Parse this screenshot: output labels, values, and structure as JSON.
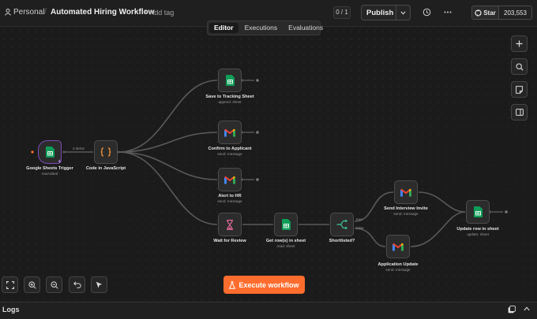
{
  "header": {
    "project": "Personal",
    "separator": "/",
    "workflow_title": "Automated Hiring Workflow",
    "add_tag": "+ Add tag",
    "counter": "0 / 1",
    "publish": "Publish",
    "star_label": "Star",
    "star_count": "203,553"
  },
  "tabs": [
    {
      "label": "Editor",
      "active": true
    },
    {
      "label": "Executions",
      "active": false
    },
    {
      "label": "Evaluations",
      "active": false
    }
  ],
  "nodes": {
    "trigger": {
      "label": "Google Sheets Trigger",
      "sub": "rowAdded",
      "icon": "google-sheets-icon"
    },
    "code": {
      "label": "Code in JavaScript",
      "sub": "",
      "icon": "code-braces-icon"
    },
    "save_tracking": {
      "label": "Save to Tracking Sheet",
      "sub": "append: sheet",
      "icon": "google-sheets-icon"
    },
    "confirm": {
      "label": "Confirm to Applicant",
      "sub": "send: message",
      "icon": "gmail-icon"
    },
    "alert_hr": {
      "label": "Alert to HR",
      "sub": "send: message",
      "icon": "gmail-icon"
    },
    "wait": {
      "label": "Wait for Review",
      "sub": "",
      "icon": "hourglass-icon"
    },
    "get_rows": {
      "label": "Get row(s) in sheet",
      "sub": "read: sheet",
      "icon": "google-sheets-icon"
    },
    "shortlisted": {
      "label": "Shortlisted?",
      "sub": "",
      "icon": "if-branch-icon"
    },
    "interview": {
      "label": "Send Interview Invite",
      "sub": "send: message",
      "icon": "gmail-icon"
    },
    "app_update": {
      "label": "Application Update",
      "sub": "send: message",
      "icon": "gmail-icon"
    },
    "update_row": {
      "label": "Update row in sheet",
      "sub": "update: sheet",
      "icon": "google-sheets-icon"
    }
  },
  "edge_labels": {
    "items": "2 items",
    "true": "true",
    "false": "false"
  },
  "execute": "Execute workflow",
  "logs": "Logs",
  "colors": {
    "accent": "#ff6d2e",
    "trigger_border": "#7b4bb7",
    "sheets_green": "#0f9d58",
    "canvas_bg": "#1b1b1b"
  }
}
